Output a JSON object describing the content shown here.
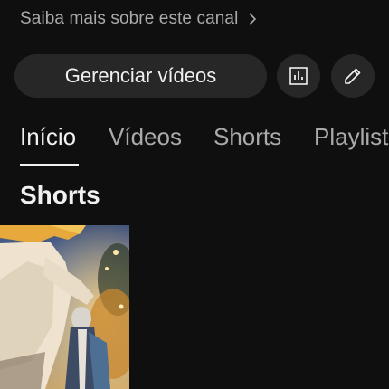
{
  "channel": {
    "learn_more": "Saiba mais sobre este canal"
  },
  "actions": {
    "manage_videos": "Gerenciar vídeos",
    "stats_icon": "analytics-icon",
    "edit_icon": "pencil-icon"
  },
  "tabs": [
    {
      "label": "Início",
      "active": true
    },
    {
      "label": "Vídeos",
      "active": false
    },
    {
      "label": "Shorts",
      "active": false
    },
    {
      "label": "Playlists",
      "active": false
    }
  ],
  "section": {
    "title": "Shorts"
  },
  "colors": {
    "background": "#0f0f0f",
    "button": "#272727",
    "text_primary": "#f1f1f1",
    "text_secondary": "#aaaaaa"
  }
}
